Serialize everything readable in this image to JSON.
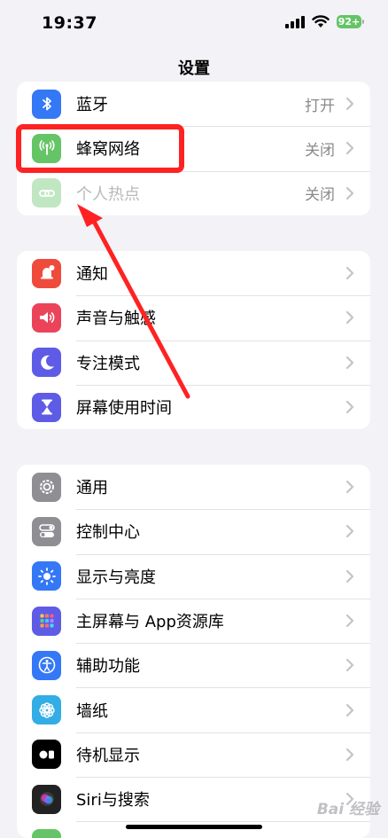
{
  "status_bar": {
    "time": "19:37",
    "battery": "92+"
  },
  "nav": {
    "title": "设置"
  },
  "group1": [
    {
      "label": "蓝牙",
      "value": "打开",
      "icon": "bluetooth-icon",
      "color": "#3478f6"
    },
    {
      "label": "蜂窝网络",
      "value": "关闭",
      "icon": "cellular-icon",
      "color": "#65c466"
    },
    {
      "label": "个人热点",
      "value": "关闭",
      "icon": "hotspot-icon",
      "color": "#65c466"
    }
  ],
  "group2": [
    {
      "label": "通知",
      "icon": "notifications-icon",
      "color": "#ef4b3c"
    },
    {
      "label": "声音与触感",
      "icon": "sounds-icon",
      "color": "#eb445a"
    },
    {
      "label": "专注模式",
      "icon": "focus-moon-icon",
      "color": "#5e5ce6"
    },
    {
      "label": "屏幕使用时间",
      "icon": "screen-time-icon",
      "color": "#5e5ce6"
    }
  ],
  "group3": [
    {
      "label": "通用",
      "icon": "general-gear-icon",
      "color": "#8e8e93"
    },
    {
      "label": "控制中心",
      "icon": "control-center-icon",
      "color": "#8e8e93"
    },
    {
      "label": "显示与亮度",
      "icon": "display-sun-icon",
      "color": "#3478f6"
    },
    {
      "label": "主屏幕与 App资源库",
      "icon": "home-screen-icon",
      "color": "#5e5ce6"
    },
    {
      "label": "辅助功能",
      "icon": "accessibility-icon",
      "color": "#3478f6"
    },
    {
      "label": "墙纸",
      "icon": "wallpaper-flower-icon",
      "color": "#32ade6"
    },
    {
      "label": "待机显示",
      "icon": "standby-icon",
      "color": "#000000"
    },
    {
      "label": "Siri与搜索",
      "icon": "siri-icon",
      "color": "#222222"
    }
  ],
  "watermark": "Bai 经验"
}
